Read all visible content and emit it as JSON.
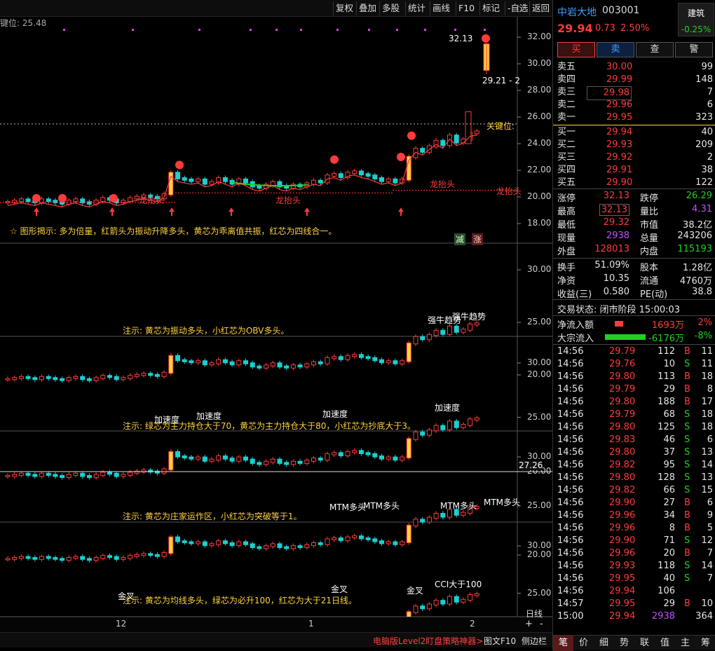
{
  "toolbar": {
    "items": [
      "复权",
      "叠加",
      "多股",
      "统计",
      "画线",
      "F10",
      "标记",
      "-自选",
      "返回"
    ]
  },
  "keypos": "键位: 25.48",
  "panels": {
    "main": {
      "note": "☆ 图形揭示: 多为倍量，红箭头为振动升降多头，黄芯为乖离值共振，红芯为四线合一。",
      "ticks": [
        "32.00",
        "30.00",
        "28.00",
        "26.00",
        "24.00",
        "22.00",
        "20.00",
        "18.00"
      ],
      "ann_high": "32.13",
      "ann_low": "29.21 - 2",
      "keypos_text": "关键位:",
      "longtai": [
        "龙抬头",
        "龙抬头",
        "龙抬头",
        "龙抬头"
      ],
      "badges": [
        "减",
        "涨"
      ]
    },
    "p2": {
      "note": "注示: 黄芯为振动多头，小红芯为OBV多头。",
      "ticks": [
        "30.00",
        "25.00",
        "20.00"
      ],
      "labels": [
        "强牛趋势",
        "强牛趋势"
      ]
    },
    "p3": {
      "note": "注示: 绿芯为主力持仓大于70，黄芯为主力持仓大于80，小红芯为抄底大于3。",
      "ticks": [
        "30.00",
        "25.00",
        "20.00"
      ],
      "labels": [
        "加速度",
        "加速度",
        "加速度",
        "加速度"
      ]
    },
    "p4": {
      "note": "注示: 黄芯为庄家运作区，小红芯为突破等于1。",
      "ticks": [
        "30.00",
        "25.00",
        "20.00"
      ],
      "extra": "27.26",
      "labels": [
        "MTM多头",
        "MTM多头",
        "MTM多头",
        "MTM多头"
      ]
    },
    "p5": {
      "note": "注示: 黄芯为均线多头，绿芯为必升100，红芯为大于21日线。",
      "ticks": [
        "30.00",
        "25.00",
        "20.00"
      ],
      "labels": [
        "金叉",
        "金叉",
        "金叉",
        "CCI大于100"
      ]
    }
  },
  "xaxis": {
    "labels": [
      "12",
      "1",
      "2"
    ],
    "period": "日线"
  },
  "status": {
    "promo": "电脑版Level2盯盘策略神器>",
    "btn1": "图文F10",
    "btn2": "侧边栏"
  },
  "stock": {
    "name": "中岩大地",
    "code": "003001",
    "price": "29.94",
    "change": "0.73",
    "pct": "2.50%",
    "sector": "建筑",
    "sector_pct": "-0.25%"
  },
  "actions": [
    "买",
    "卖",
    "查",
    "警"
  ],
  "asks": [
    {
      "l": "卖五",
      "p": "30.00",
      "v": "99"
    },
    {
      "l": "卖四",
      "p": "29.99",
      "v": "148"
    },
    {
      "l": "卖三",
      "p": "29.98",
      "v": "7"
    },
    {
      "l": "卖二",
      "p": "29.96",
      "v": "6"
    },
    {
      "l": "卖一",
      "p": "29.95",
      "v": "323"
    }
  ],
  "bids": [
    {
      "l": "买一",
      "p": "29.94",
      "v": "40"
    },
    {
      "l": "买二",
      "p": "29.93",
      "v": "209"
    },
    {
      "l": "买三",
      "p": "29.92",
      "v": "2"
    },
    {
      "l": "买四",
      "p": "29.91",
      "v": "38"
    },
    {
      "l": "买五",
      "p": "29.90",
      "v": "122"
    }
  ],
  "stats": [
    [
      {
        "k": "涨停",
        "v": "32.13",
        "c": "red"
      },
      {
        "k": "跌停",
        "v": "26.29",
        "c": "green"
      }
    ],
    [
      {
        "k": "最高",
        "v": "32.13",
        "c": "red"
      },
      {
        "k": "量比",
        "v": "4.31",
        "c": "purple"
      }
    ],
    [
      {
        "k": "最低",
        "v": "29.32",
        "c": "red"
      },
      {
        "k": "市值",
        "v": "38.2亿",
        "c": "white"
      }
    ],
    [
      {
        "k": "现量",
        "v": "2938",
        "c": "purple"
      },
      {
        "k": "总量",
        "v": "243206",
        "c": "white"
      }
    ],
    [
      {
        "k": "外盘",
        "v": "128013",
        "c": "red"
      },
      {
        "k": "内盘",
        "v": "115193",
        "c": "green"
      }
    ],
    [
      {
        "k": "换手",
        "v": "51.09%",
        "c": "white"
      },
      {
        "k": "股本",
        "v": "1.28亿",
        "c": "white"
      }
    ],
    [
      {
        "k": "净资",
        "v": "10.35",
        "c": "white"
      },
      {
        "k": "流通",
        "v": "4760万",
        "c": "white"
      }
    ],
    [
      {
        "k": "收益(三)",
        "v": "0.580",
        "c": "white"
      },
      {
        "k": "PE(动)",
        "v": "38.8",
        "c": "white"
      }
    ]
  ],
  "trade_status": "交易状态: 闭市阶段 15:00:03",
  "flows": [
    {
      "k": "净流入额",
      "v": "1693万",
      "p": "2%",
      "c": "red"
    },
    {
      "k": "大宗流入",
      "v": "-6176万",
      "p": "-8%",
      "c": "green"
    }
  ],
  "ticks": [
    [
      "14:56",
      "29.79",
      "112",
      "B",
      "11"
    ],
    [
      "14:56",
      "29.76",
      "10",
      "S",
      "11"
    ],
    [
      "14:56",
      "29.80",
      "113",
      "B",
      "18"
    ],
    [
      "14:56",
      "29.79",
      "29",
      "B",
      "8"
    ],
    [
      "14:56",
      "29.80",
      "188",
      "B",
      "17"
    ],
    [
      "14:56",
      "29.79",
      "68",
      "S",
      "18"
    ],
    [
      "14:56",
      "29.80",
      "125",
      "S",
      "18"
    ],
    [
      "14:56",
      "29.83",
      "46",
      "S",
      "6"
    ],
    [
      "14:56",
      "29.80",
      "37",
      "S",
      "13"
    ],
    [
      "14:56",
      "29.82",
      "95",
      "S",
      "14"
    ],
    [
      "14:56",
      "29.80",
      "128",
      "S",
      "13"
    ],
    [
      "14:56",
      "29.82",
      "66",
      "S",
      "15"
    ],
    [
      "14:56",
      "29.90",
      "27",
      "B",
      "6"
    ],
    [
      "14:56",
      "29.96",
      "34",
      "B",
      "9"
    ],
    [
      "14:56",
      "29.96",
      "8",
      "B",
      "5"
    ],
    [
      "14:56",
      "29.90",
      "71",
      "S",
      "12"
    ],
    [
      "14:56",
      "29.96",
      "20",
      "B",
      "7"
    ],
    [
      "14:56",
      "29.93",
      "118",
      "S",
      "14"
    ],
    [
      "14:56",
      "29.95",
      "40",
      "S",
      "7"
    ],
    [
      "14:56",
      "29.94",
      "106",
      "",
      ""
    ],
    [
      "14:57",
      "29.95",
      "29",
      "B",
      "10"
    ],
    [
      "15:00",
      "29.94",
      "2938",
      "",
      "364"
    ]
  ],
  "bottom_tabs": [
    "笔",
    "价",
    "细",
    "势",
    "联",
    "值",
    "主",
    "筹"
  ]
}
